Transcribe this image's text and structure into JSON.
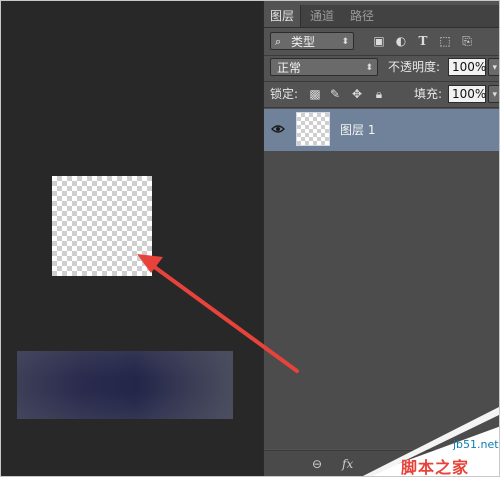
{
  "panel": {
    "tabs": [
      {
        "label": "图层"
      },
      {
        "label": "通道"
      },
      {
        "label": "路径"
      }
    ],
    "filter": {
      "label": "类型",
      "search_icon": "search-icon"
    },
    "filter_icons": [
      "image-filter-icon",
      "adjustment-filter-icon",
      "type-filter-icon",
      "shape-filter-icon",
      "smart-object-filter-icon"
    ],
    "blend_mode": "正常",
    "opacity_label": "不透明度:",
    "opacity_value": "100%",
    "lock_label": "锁定:",
    "fill_label": "填充:",
    "fill_value": "100%",
    "layer": {
      "name": "图层 1",
      "visibility_icon": "eye-icon"
    },
    "bottom_icons": {
      "link": "link-icon",
      "fx": "fx"
    }
  },
  "watermark": {
    "site": "jb51.net",
    "name": "脚本之家"
  },
  "colors": {
    "panel_bg": "#535353",
    "selected_layer": "#6f8299",
    "canvas_bg": "#282828",
    "arrow": "#e8433a"
  }
}
